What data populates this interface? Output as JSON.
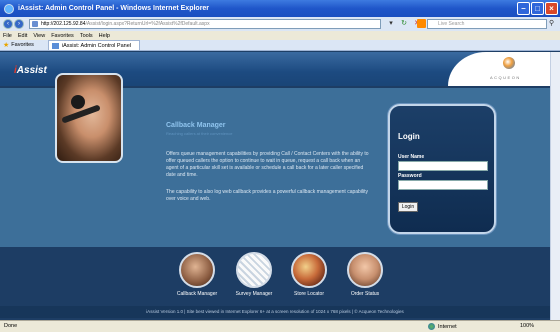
{
  "window": {
    "title": "iAssist: Admin Control Panel - Windows Internet Explorer"
  },
  "address": {
    "host": "http://202.125.92.84",
    "path": "/Assist/login.aspx?ReturnUrl=%2fAssist%2fDefault.aspx"
  },
  "search": {
    "placeholder": "Live Search"
  },
  "menu": [
    "File",
    "Edit",
    "View",
    "Favorites",
    "Tools",
    "Help"
  ],
  "favorites": {
    "label": "Favorites",
    "tab_title": "iAssist: Admin Control Panel"
  },
  "header": {
    "logo_prefix": "i",
    "logo_text": "Assist",
    "brand": "ACQUEON"
  },
  "callback": {
    "title": "Callback Manager",
    "subtitle": "Reaching callers at their convenience",
    "paragraph1": "Offers queue management capabilities by providing Call / Contact Centers with the ability to offer queued callers the option to continue to wait in queue, request a call back when an agent of a particular skill set is available or schedule a call back for a later caller specified date and time.",
    "paragraph2": "The capability to also log web callback provides a powerful callback management capability over voice and web."
  },
  "login": {
    "title": "Login",
    "username_label": "User Name",
    "password_label": "Password",
    "button": "Login"
  },
  "nav": [
    "Callback Manager",
    "Survey Manager",
    "Store Locator",
    "Order Status"
  ],
  "footer": "iAssist Version 1.0 | Site best viewed in Internet Explorer 6+ at a screen resolution of 1024 x 768 pixels | © Acqueon Technologies",
  "status": {
    "left": "Done",
    "zone": "Internet",
    "zoom": "100%"
  }
}
